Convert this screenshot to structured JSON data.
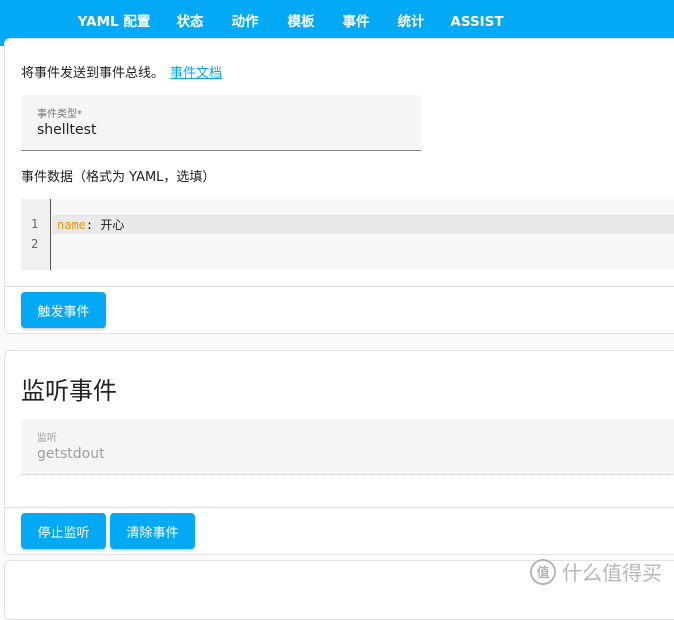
{
  "tabs": [
    {
      "label": "YAML 配置",
      "active": false
    },
    {
      "label": "状态",
      "active": false
    },
    {
      "label": "动作",
      "active": false
    },
    {
      "label": "模板",
      "active": false
    },
    {
      "label": "事件",
      "active": true
    },
    {
      "label": "统计",
      "active": false
    },
    {
      "label": "ASSIST",
      "active": false
    }
  ],
  "fire_event": {
    "description": "将事件发送到事件总线。",
    "docs_link": "事件文档",
    "event_type": {
      "label": "事件类型*",
      "value": "shelltest"
    },
    "data_label": "事件数据（格式为 YAML，选填）",
    "editor": {
      "line_numbers": [
        "1",
        "2"
      ],
      "key": "name",
      "separator": ": ",
      "value": "开心"
    },
    "fire_button": "触发事件"
  },
  "listen": {
    "title": "监听事件",
    "field": {
      "label": "监听",
      "value": "getstdout"
    },
    "stop_button": "停止监听",
    "clear_button": "清除事件"
  },
  "watermark": {
    "logo": "值",
    "text": "什么值得买"
  },
  "colors": {
    "accent": "#03a9f4",
    "yaml_key": "#e6970e"
  }
}
